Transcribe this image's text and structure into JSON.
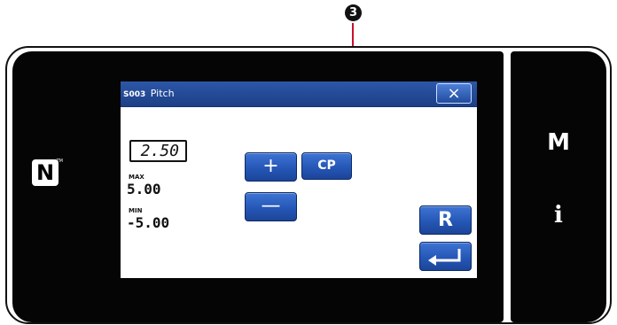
{
  "callout": {
    "number": "3"
  },
  "side_panel": {
    "m_label": "M",
    "info_label": "i"
  },
  "nfc": {
    "letter": "N",
    "tm": "TM"
  },
  "dialog": {
    "code": "S003",
    "title": "Pitch",
    "current_value": "2.50",
    "max_label": "MAX",
    "max_value": "5.00",
    "min_label": "MIN",
    "min_value": "-5.00",
    "plus_label": "+",
    "minus_label": "—",
    "cp_label": "CP",
    "reset_label": "R",
    "close_label": "×"
  },
  "colors": {
    "accent": "#2557b6",
    "callout": "#c8102e",
    "bezel": "#050505"
  }
}
